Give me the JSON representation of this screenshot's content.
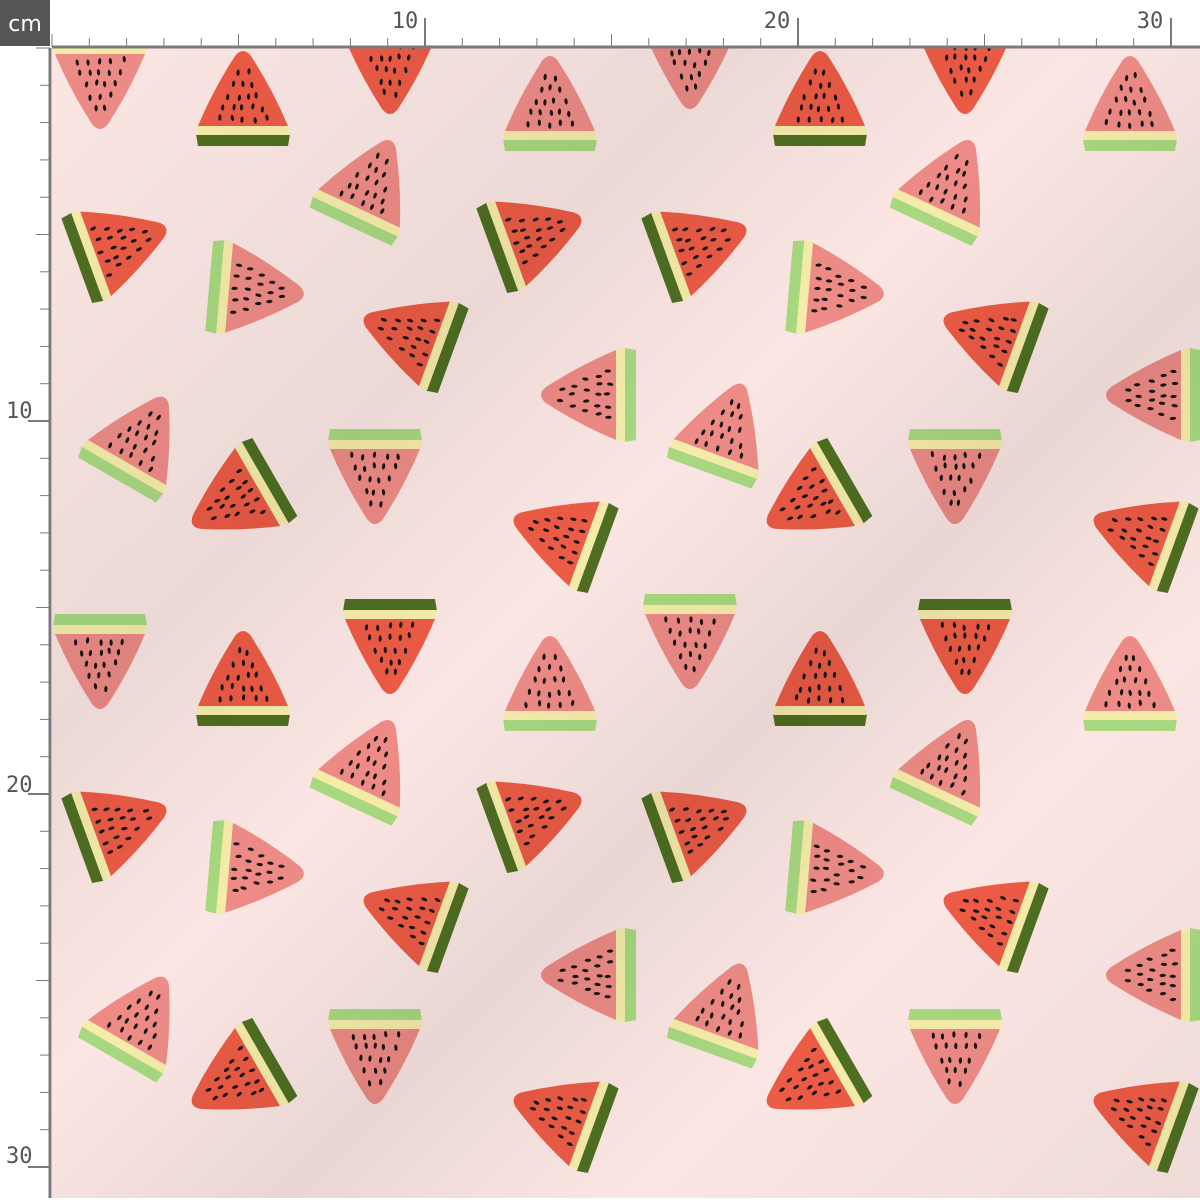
{
  "ruler": {
    "unit": "cm",
    "top_labels": [
      "10",
      "20",
      "30"
    ],
    "left_labels": [
      "10",
      "20",
      "30"
    ]
  },
  "fabric": {
    "motif": "watermelon-slice",
    "colors": {
      "background": "#fbe6e3",
      "red_flesh": "#ec5b45",
      "pink_flesh": "#ee8b86",
      "rind_dark": "#4f6e22",
      "rind_light": "#a8d880",
      "pith": "#f6ecaa",
      "seed": "#1a1414",
      "ruler_bg": "#ffffff",
      "ruler_line": "#7a7a7a",
      "unit_box": "#555555"
    }
  }
}
